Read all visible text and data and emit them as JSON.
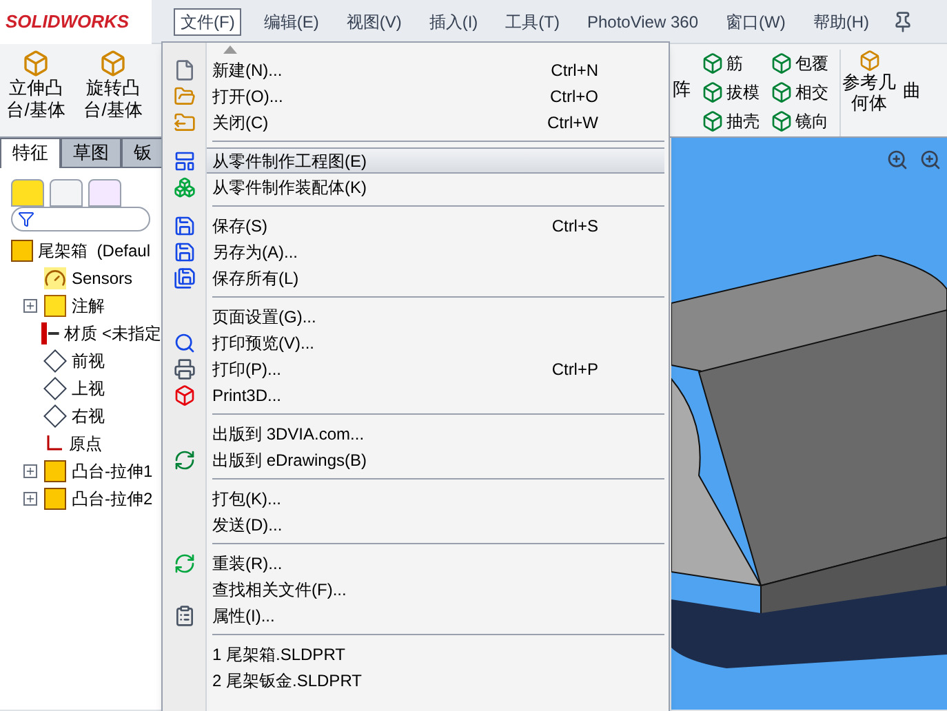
{
  "logo": "SOLIDWORKS",
  "menu_bar": [
    {
      "label": "文件(F)",
      "selected": true
    },
    {
      "label": "编辑(E)",
      "selected": false
    },
    {
      "label": "视图(V)",
      "selected": false
    },
    {
      "label": "插入(I)",
      "selected": false
    },
    {
      "label": "工具(T)",
      "selected": false
    },
    {
      "label": "PhotoView 360",
      "selected": false
    },
    {
      "label": "窗口(W)",
      "selected": false
    },
    {
      "label": "帮助(H)",
      "selected": false
    }
  ],
  "toolbar_left": [
    {
      "lines": [
        "立伸凸",
        "台/基体"
      ]
    },
    {
      "lines": [
        "旋转凸",
        "台/基体"
      ]
    }
  ],
  "toolbar_right_cut": "阵",
  "toolbar_right": [
    [
      {
        "label": "筋"
      },
      {
        "label": "拔模"
      },
      {
        "label": "抽壳"
      }
    ],
    [
      {
        "label": "包覆"
      },
      {
        "label": "相交"
      },
      {
        "label": "镜向"
      }
    ]
  ],
  "reference_button": {
    "lines": [
      "参考几",
      "何体"
    ]
  },
  "toolbar_edge": "曲",
  "command_tabs": [
    {
      "label": "特征",
      "selected": true
    },
    {
      "label": "草图",
      "selected": false
    },
    {
      "label": "钣",
      "selected": false
    }
  ],
  "feature_tree": {
    "root": "尾架箱  (Defaul",
    "items": [
      {
        "kind": "sensors",
        "label": "Sensors",
        "expandable": false
      },
      {
        "kind": "annotations",
        "label": "注解",
        "expandable": true
      },
      {
        "kind": "material",
        "label": "材质 <未指定",
        "expandable": false
      },
      {
        "kind": "plane",
        "label": "前视",
        "expandable": false
      },
      {
        "kind": "plane",
        "label": "上视",
        "expandable": false
      },
      {
        "kind": "plane",
        "label": "右视",
        "expandable": false
      },
      {
        "kind": "origin",
        "label": "原点",
        "expandable": false
      },
      {
        "kind": "feature",
        "label": "凸台-拉伸1",
        "expandable": true
      },
      {
        "kind": "feature",
        "label": "凸台-拉伸2",
        "expandable": true
      }
    ]
  },
  "file_menu": [
    {
      "kind": "new",
      "label": "新建(N)...",
      "shortcut": "Ctrl+N",
      "selected": false
    },
    {
      "kind": "open",
      "label": "打开(O)...",
      "shortcut": "Ctrl+O",
      "selected": false
    },
    {
      "kind": "close",
      "label": "关闭(C)",
      "shortcut": "Ctrl+W",
      "selected": false
    },
    {
      "kind": "separator"
    },
    {
      "kind": "drawing",
      "label": "从零件制作工程图(E)",
      "selected": true
    },
    {
      "kind": "assembly",
      "label": "从零件制作装配体(K)",
      "selected": false
    },
    {
      "kind": "separator"
    },
    {
      "kind": "save",
      "label": "保存(S)",
      "shortcut": "Ctrl+S",
      "selected": false
    },
    {
      "kind": "saveas",
      "label": "另存为(A)...",
      "selected": false
    },
    {
      "kind": "saveall",
      "label": "保存所有(L)",
      "selected": false
    },
    {
      "kind": "separator"
    },
    {
      "kind": "plain",
      "label": "页面设置(G)...",
      "selected": false
    },
    {
      "kind": "preview",
      "label": "打印预览(V)...",
      "selected": false
    },
    {
      "kind": "print",
      "label": "打印(P)...",
      "shortcut": "Ctrl+P",
      "selected": false
    },
    {
      "kind": "print3d",
      "label": "Print3D...",
      "selected": false
    },
    {
      "kind": "separator"
    },
    {
      "kind": "plain",
      "label": "出版到 3DVIA.com...",
      "selected": false
    },
    {
      "kind": "edrawings",
      "label": "出版到 eDrawings(B)",
      "selected": false
    },
    {
      "kind": "separator"
    },
    {
      "kind": "plain",
      "label": "打包(K)...",
      "selected": false
    },
    {
      "kind": "plain",
      "label": "发送(D)...",
      "selected": false
    },
    {
      "kind": "separator"
    },
    {
      "kind": "reload",
      "label": "重装(R)...",
      "selected": false
    },
    {
      "kind": "plain",
      "label": "查找相关文件(F)...",
      "selected": false
    },
    {
      "kind": "properties",
      "label": "属性(I)...",
      "selected": false
    },
    {
      "kind": "separator"
    },
    {
      "kind": "plain",
      "label": "1 尾架箱.SLDPRT",
      "selected": false
    },
    {
      "kind": "plain",
      "label": "2 尾架钣金.SLDPRT",
      "selected": false
    }
  ]
}
